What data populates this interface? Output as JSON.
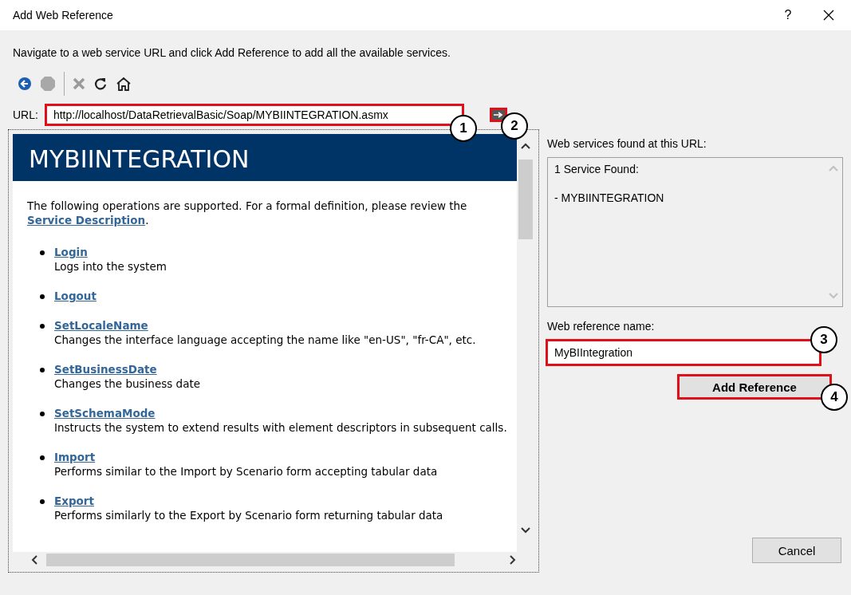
{
  "window": {
    "title": "Add Web Reference",
    "help": "?"
  },
  "instruction": "Navigate to a web service URL and click Add Reference to add all the available services.",
  "toolbar": [
    {
      "kind": "back",
      "disabled": false
    },
    {
      "kind": "stop",
      "disabled": true
    },
    {
      "kind": "delete",
      "disabled": true
    },
    {
      "kind": "refresh",
      "disabled": false
    },
    {
      "kind": "home",
      "disabled": false
    }
  ],
  "url": {
    "label": "URL:",
    "value": "http://localhost/DataRetrievalBasic/Soap/MYBIINTEGRATION.asmx",
    "highlighted": true,
    "callout": "1"
  },
  "go_button": {
    "highlighted": true,
    "callout": "2"
  },
  "page": {
    "heading": "MYBIINTEGRATION",
    "intro": "The following operations are supported. For a formal definition, please review the",
    "intro_link": "Service Description",
    "intro_end": ".",
    "operations": [
      {
        "name": "Login",
        "description": "Logs into the system"
      },
      {
        "name": "Logout"
      },
      {
        "name": "SetLocaleName",
        "description": "Changes the interface language accepting the name like \"en-US\", \"fr-CA\", etc."
      },
      {
        "name": "SetBusinessDate",
        "description": "Changes the business date"
      },
      {
        "name": "SetSchemaMode",
        "description": "Instructs the system to extend results with element descriptors in subsequent calls."
      },
      {
        "name": "Import",
        "description": "Performs similar to the Import by Scenario form accepting tabular data"
      },
      {
        "name": "Export",
        "description": "Performs similarly to the Export by Scenario form returning tabular data"
      }
    ]
  },
  "services": {
    "label": "Web services found at this URL:",
    "lines": [
      "1 Service Found:",
      "- MYBIINTEGRATION"
    ]
  },
  "reference_name": {
    "label": "Web reference name:",
    "value": "MyBIIntegration",
    "highlighted": true,
    "callout": "3"
  },
  "add_button": {
    "label": "Add Reference",
    "highlighted": true,
    "callout": "4"
  },
  "cancel_button": {
    "label": "Cancel"
  }
}
